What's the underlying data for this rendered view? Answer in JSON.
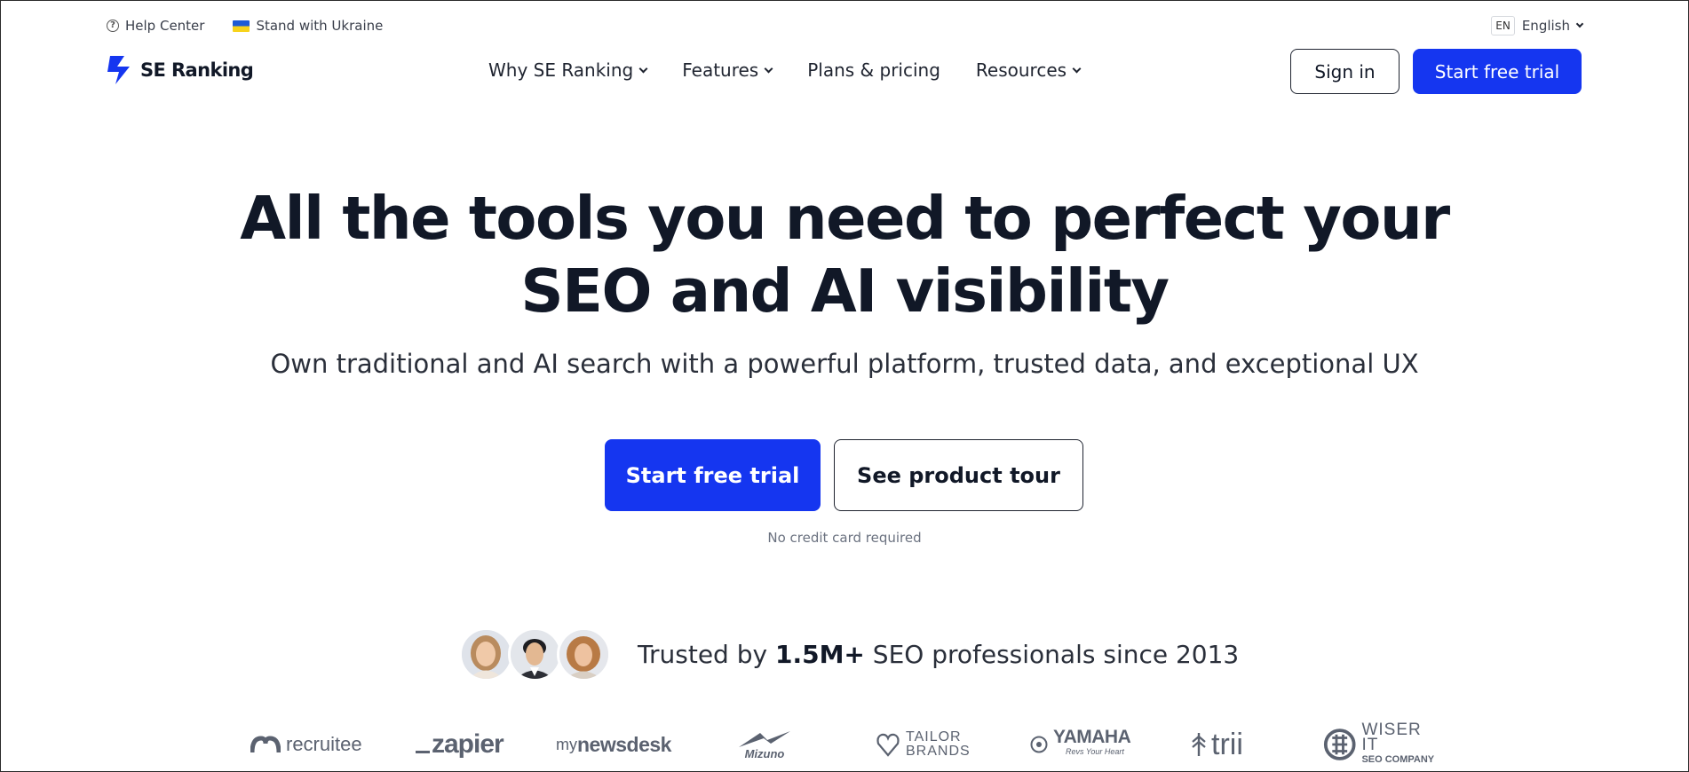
{
  "utility": {
    "help_label": "Help Center",
    "ukraine_label": "Stand with Ukraine",
    "lang_code": "EN",
    "lang_label": "English"
  },
  "brand": {
    "name": "SE Ranking",
    "accent": "#1536f0"
  },
  "nav": {
    "items": [
      {
        "label": "Why SE Ranking",
        "has_dropdown": true
      },
      {
        "label": "Features",
        "has_dropdown": true
      },
      {
        "label": "Plans & pricing",
        "has_dropdown": false
      },
      {
        "label": "Resources",
        "has_dropdown": true
      }
    ],
    "signin_label": "Sign in",
    "trial_label": "Start free trial"
  },
  "hero": {
    "title_line1": "All the tools you need to perfect your",
    "title_line2": "SEO and AI visibility",
    "subtitle": "Own traditional and AI search with a powerful platform, trusted data, and exceptional UX",
    "cta_primary": "Start free trial",
    "cta_secondary": "See product tour",
    "note": "No credit card required"
  },
  "trust": {
    "prefix": "Trusted by ",
    "highlight": "1.5M+",
    "suffix": " SEO professionals since 2013"
  },
  "client_logos": {
    "recruitee": "recruitee",
    "zapier": "zapier",
    "mynewsdesk_my": "my",
    "mynewsdesk_rest": "newsdesk",
    "mizuno": "Mizuno",
    "tailor_1": "TAILOR",
    "tailor_2": "BRANDS",
    "yamaha_1": "YAMAHA",
    "yamaha_2": "Revs Your Heart",
    "trii": "trii",
    "wiser_1": "WISER IT",
    "wiser_2": "SEO COMPANY"
  }
}
